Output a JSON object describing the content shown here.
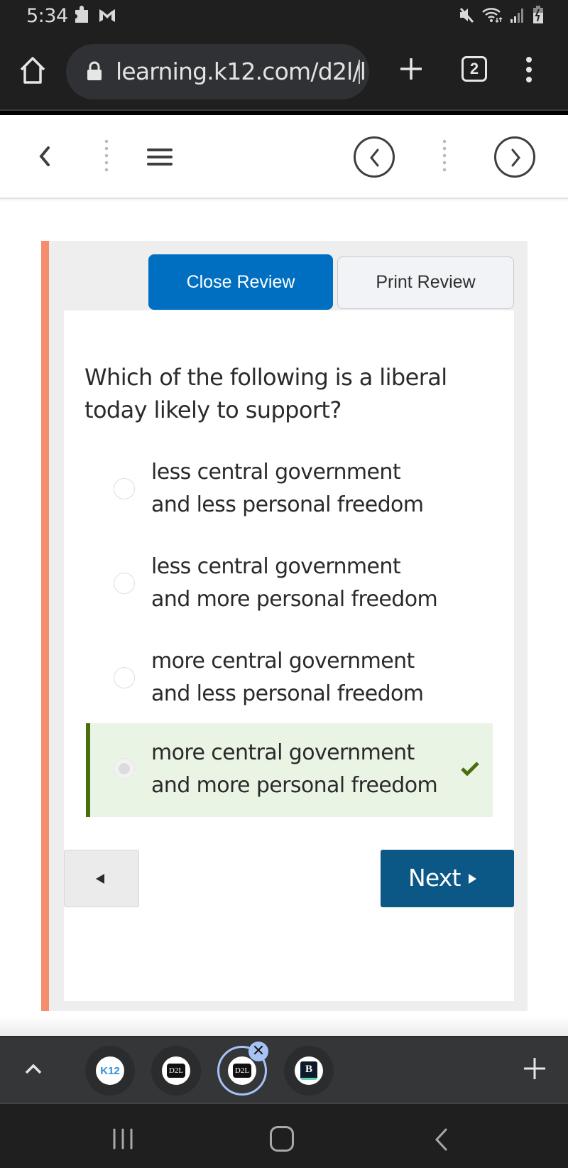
{
  "status_bar": {
    "time": "5:34",
    "left_icons": [
      "puzzle-notification-icon",
      "m-app-notification-icon"
    ],
    "right_icons": [
      "mute-icon",
      "wifi-icon",
      "signal-icon",
      "battery-charging-icon"
    ],
    "battery_level_digit": "7"
  },
  "browser": {
    "url": "learning.k12.com/d2l/l",
    "tab_count": "2",
    "buttons": [
      "home",
      "new-tab",
      "tab-switcher",
      "menu"
    ]
  },
  "page_nav": {
    "back": "back",
    "menu": "menu",
    "previous": "previous-topic",
    "next": "next-topic"
  },
  "review": {
    "close_label": "Close Review",
    "print_label": "Print Review",
    "accent_color": "#006fc2"
  },
  "question": {
    "text": "Which of the following is a liberal today likely to support?",
    "options": [
      {
        "line1": "less central government",
        "line2": "and less personal freedom",
        "selected": false,
        "correct": false
      },
      {
        "line1": "less central government",
        "line2": "and more personal freedom",
        "selected": false,
        "correct": false
      },
      {
        "line1": "more central government",
        "line2": "and less personal freedom",
        "selected": false,
        "correct": false
      },
      {
        "line1": "more central government",
        "line2": "and more personal freedom",
        "selected": true,
        "correct": true
      }
    ],
    "correct_color": "#4a6d0e"
  },
  "pager": {
    "prev_label": "",
    "next_label": "Next"
  },
  "tab_strip": {
    "tabs": [
      {
        "favicon_text": "K12",
        "active": false
      },
      {
        "favicon_text": "D2L",
        "active": false
      },
      {
        "favicon_text": "D2L",
        "active": true
      },
      {
        "favicon_text": "B",
        "active": false
      }
    ],
    "close_glyph": "✕"
  }
}
